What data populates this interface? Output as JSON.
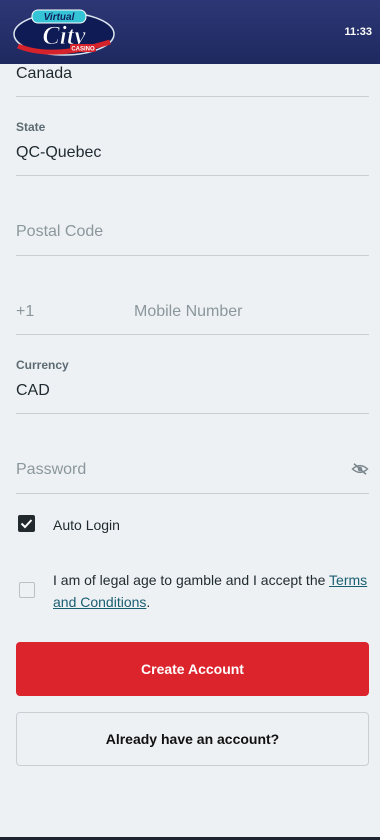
{
  "header": {
    "logo_word_top": "Virtual",
    "logo_word_main": "City",
    "logo_word_sub": "CASINO",
    "time": "11:33"
  },
  "form": {
    "country": {
      "value": "Canada"
    },
    "state": {
      "label": "State",
      "value": "QC-Quebec"
    },
    "postal_code": {
      "placeholder": "Postal Code"
    },
    "mobile": {
      "prefix": "+1",
      "placeholder": "Mobile Number"
    },
    "currency": {
      "label": "Currency",
      "value": "CAD"
    },
    "password": {
      "placeholder": "Password"
    },
    "auto_login": {
      "label": "Auto Login",
      "checked": true
    },
    "legal": {
      "text": "I am of legal age to gamble and I accept the ",
      "link_part1": "Terms",
      "link_part2": "and Conditions",
      "suffix": ".",
      "checked": false
    }
  },
  "buttons": {
    "create_account": "Create Account",
    "already_have_account": "Already have an account?"
  },
  "colors": {
    "header_bg": "#25306a",
    "primary_button": "#dc242d",
    "link": "#1a5e72",
    "background": "#eef1f3"
  },
  "icons": {
    "password_toggle": "eye-off-icon",
    "checkbox_checked": "check-icon"
  }
}
